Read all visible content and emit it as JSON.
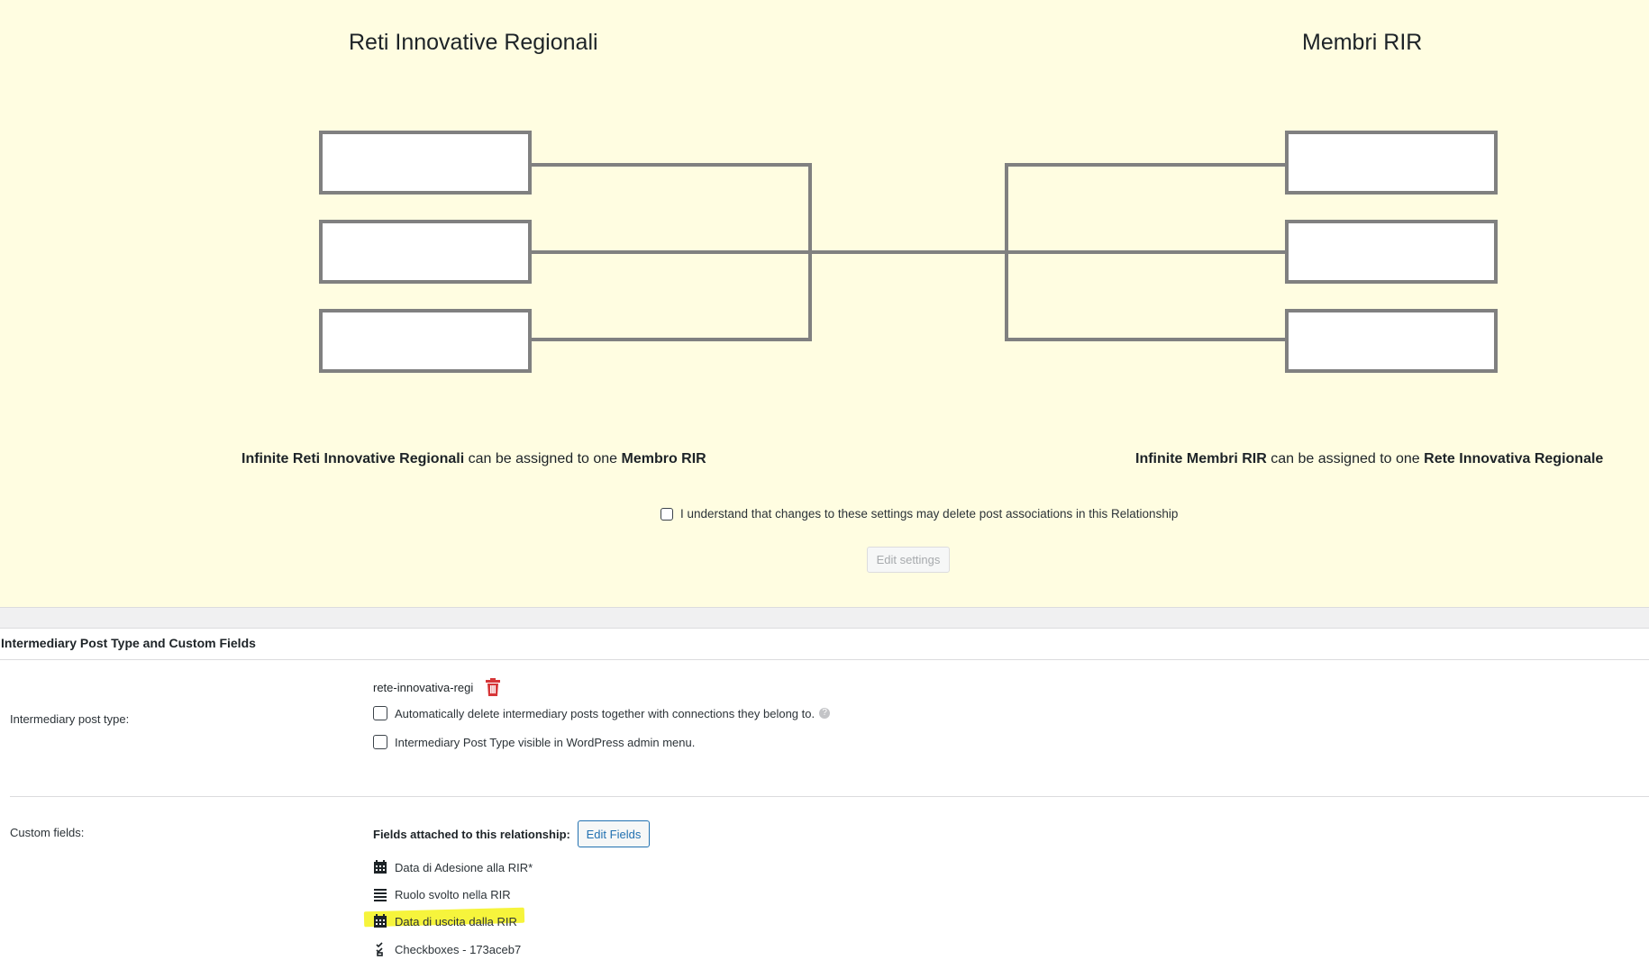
{
  "relationship": {
    "left_title": "Reti Innovative Regionali",
    "right_title": "Membri RIR",
    "left_caption": {
      "a": "Infinite Reti Innovative Regionali",
      "b": " can be assigned to one ",
      "c": "Membro RIR"
    },
    "right_caption": {
      "a": "Infinite Membri RIR",
      "b": " can be assigned to one ",
      "c": "Rete Innovativa Regionale"
    },
    "understand_label": "I understand that changes to these settings may delete post associations in this Relationship",
    "understand_checked": false,
    "edit_settings_label": "Edit settings"
  },
  "intermediary": {
    "section_title": "Intermediary Post Type and Custom Fields",
    "post_type_label": "Intermediary post type:",
    "post_type_slug": "rete-innovativa-regi",
    "options": [
      {
        "label": "Automatically delete intermediary posts together with connections they belong to.",
        "checked": false,
        "help": "?"
      },
      {
        "label": "Intermediary Post Type visible in WordPress admin menu.",
        "checked": false
      }
    ],
    "custom_fields_label": "Custom fields:",
    "fields_attached_label": "Fields attached to this relationship:",
    "edit_fields_label": "Edit Fields",
    "fields": [
      {
        "icon": "calendar-icon",
        "label": "Data di Adesione alla RIR*"
      },
      {
        "icon": "lines-icon",
        "label": "Ruolo svolto nella RIR"
      },
      {
        "icon": "calendar-icon",
        "label": "Data di uscita dalla RIR"
      },
      {
        "icon": "checkboxes-icon",
        "label": "Checkboxes - 173aceb7"
      }
    ]
  },
  "colors": {
    "panel_bg": "#fffde1",
    "diagram_stroke": "#808080",
    "trash": "#d63638",
    "highlight": "#f5f21a",
    "accent": "#2271b1"
  }
}
